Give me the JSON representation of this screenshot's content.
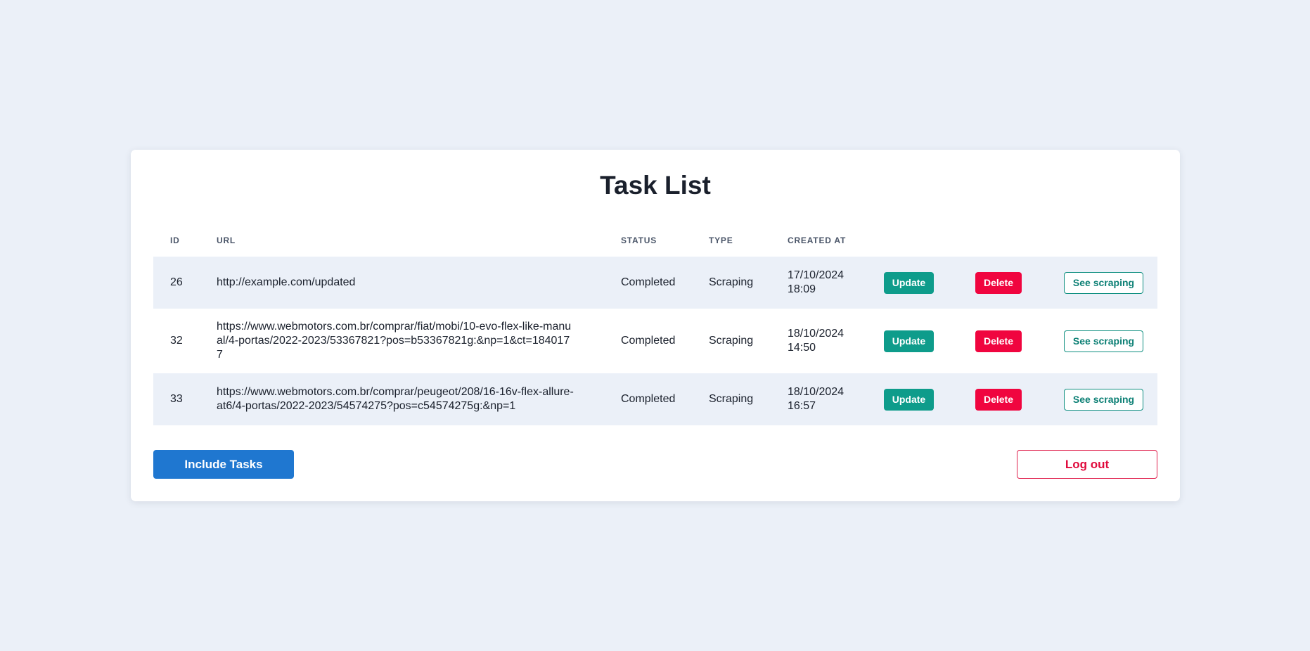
{
  "page": {
    "title": "Task List"
  },
  "table": {
    "headers": [
      "ID",
      "URL",
      "STATUS",
      "TYPE",
      "CREATED AT"
    ],
    "rows": [
      {
        "id": "26",
        "url": "http://example.com/updated",
        "status": "Completed",
        "type": "Scraping",
        "created_date": "17/10/2024",
        "created_time": "18:09",
        "update_label": "Update",
        "delete_label": "Delete",
        "see_label": "See scraping"
      },
      {
        "id": "32",
        "url": "https://www.webmotors.com.br/comprar/fiat/mobi/10-evo-flex-like-manual/4-portas/2022-2023/53367821?pos=b53367821g:&np=1&ct=1840177",
        "status": "Completed",
        "type": "Scraping",
        "created_date": "18/10/2024",
        "created_time": "14:50",
        "update_label": "Update",
        "delete_label": "Delete",
        "see_label": "See scraping"
      },
      {
        "id": "33",
        "url": "https://www.webmotors.com.br/comprar/peugeot/208/16-16v-flex-allure-at6/4-portas/2022-2023/54574275?pos=c54574275g:&np=1",
        "status": "Completed",
        "type": "Scraping",
        "created_date": "18/10/2024",
        "created_time": "16:57",
        "update_label": "Update",
        "delete_label": "Delete",
        "see_label": "See scraping"
      }
    ]
  },
  "footer": {
    "include_label": "Include Tasks",
    "logout_label": "Log out"
  },
  "colors": {
    "page_background": "#ebf0f8",
    "update_button": "#0e9c8b",
    "delete_button": "#f0053f",
    "see_scraping_border": "#0e8f80",
    "include_button": "#1f77d0",
    "logout_accent": "#e00a3c"
  }
}
